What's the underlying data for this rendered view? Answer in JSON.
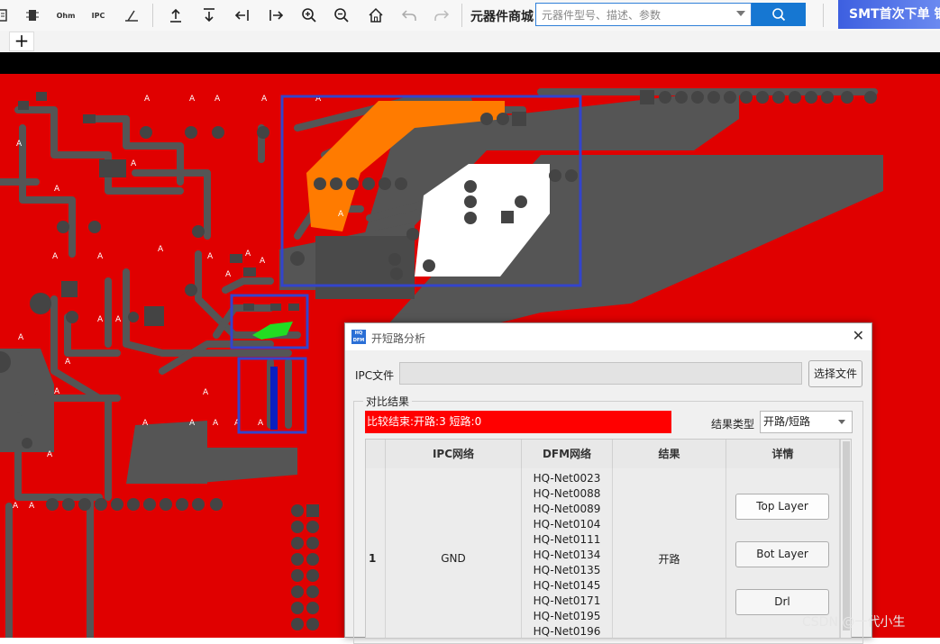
{
  "toolbar": {
    "left_icons": [
      "part-icon",
      "chip-icon",
      "ohm-icon",
      "ipc-icon",
      "measure-icon"
    ],
    "icon_texts": {
      "ohm": "Ohm",
      "ipc": "IPC"
    },
    "nav_icons": [
      "upload-icon",
      "download-icon",
      "align-left-icon",
      "align-right-icon",
      "zoom-in-icon",
      "zoom-out-icon",
      "home-icon",
      "undo-icon",
      "redo-icon"
    ],
    "store_title": "元器件商城",
    "search_placeholder": "元器件型号、描述、参数",
    "banner": "SMT首次下单 钢"
  },
  "tabs": {
    "add_label": "+"
  },
  "colors": {
    "board": "#e00000",
    "trace": "#555555",
    "highlight_box": "#3344cc",
    "copper_orange": "#ff7b00",
    "short_green": "#22dd22",
    "accent_blue": "#1677d2"
  },
  "dialog": {
    "title": "开短路分析",
    "logo_text": "HQ DFM",
    "close_label": "✕",
    "ipc_label": "IPC文件",
    "ipc_path": "",
    "choose_file_btn": "选择文件",
    "group_label": "对比结果",
    "result_text": "比较结束:开路:3 短路:0",
    "result_type_label": "结果类型",
    "result_type_value": "开路/短路",
    "columns": [
      "IPC网络",
      "DFM网络",
      "结果",
      "详情"
    ],
    "rows": [
      {
        "index": "1",
        "ipc_net": "GND",
        "dfm_nets": [
          "HQ-Net0023",
          "HQ-Net0088",
          "HQ-Net0089",
          "HQ-Net0104",
          "HQ-Net0111",
          "HQ-Net0134",
          "HQ-Net0135",
          "HQ-Net0145",
          "HQ-Net0171",
          "HQ-Net0195",
          "HQ-Net0196"
        ],
        "result": "开路",
        "details": [
          "Top Layer",
          "Bot Layer",
          "Drl"
        ]
      }
    ]
  },
  "watermark": "CSDN @一代小生",
  "pcb_marker": "A"
}
